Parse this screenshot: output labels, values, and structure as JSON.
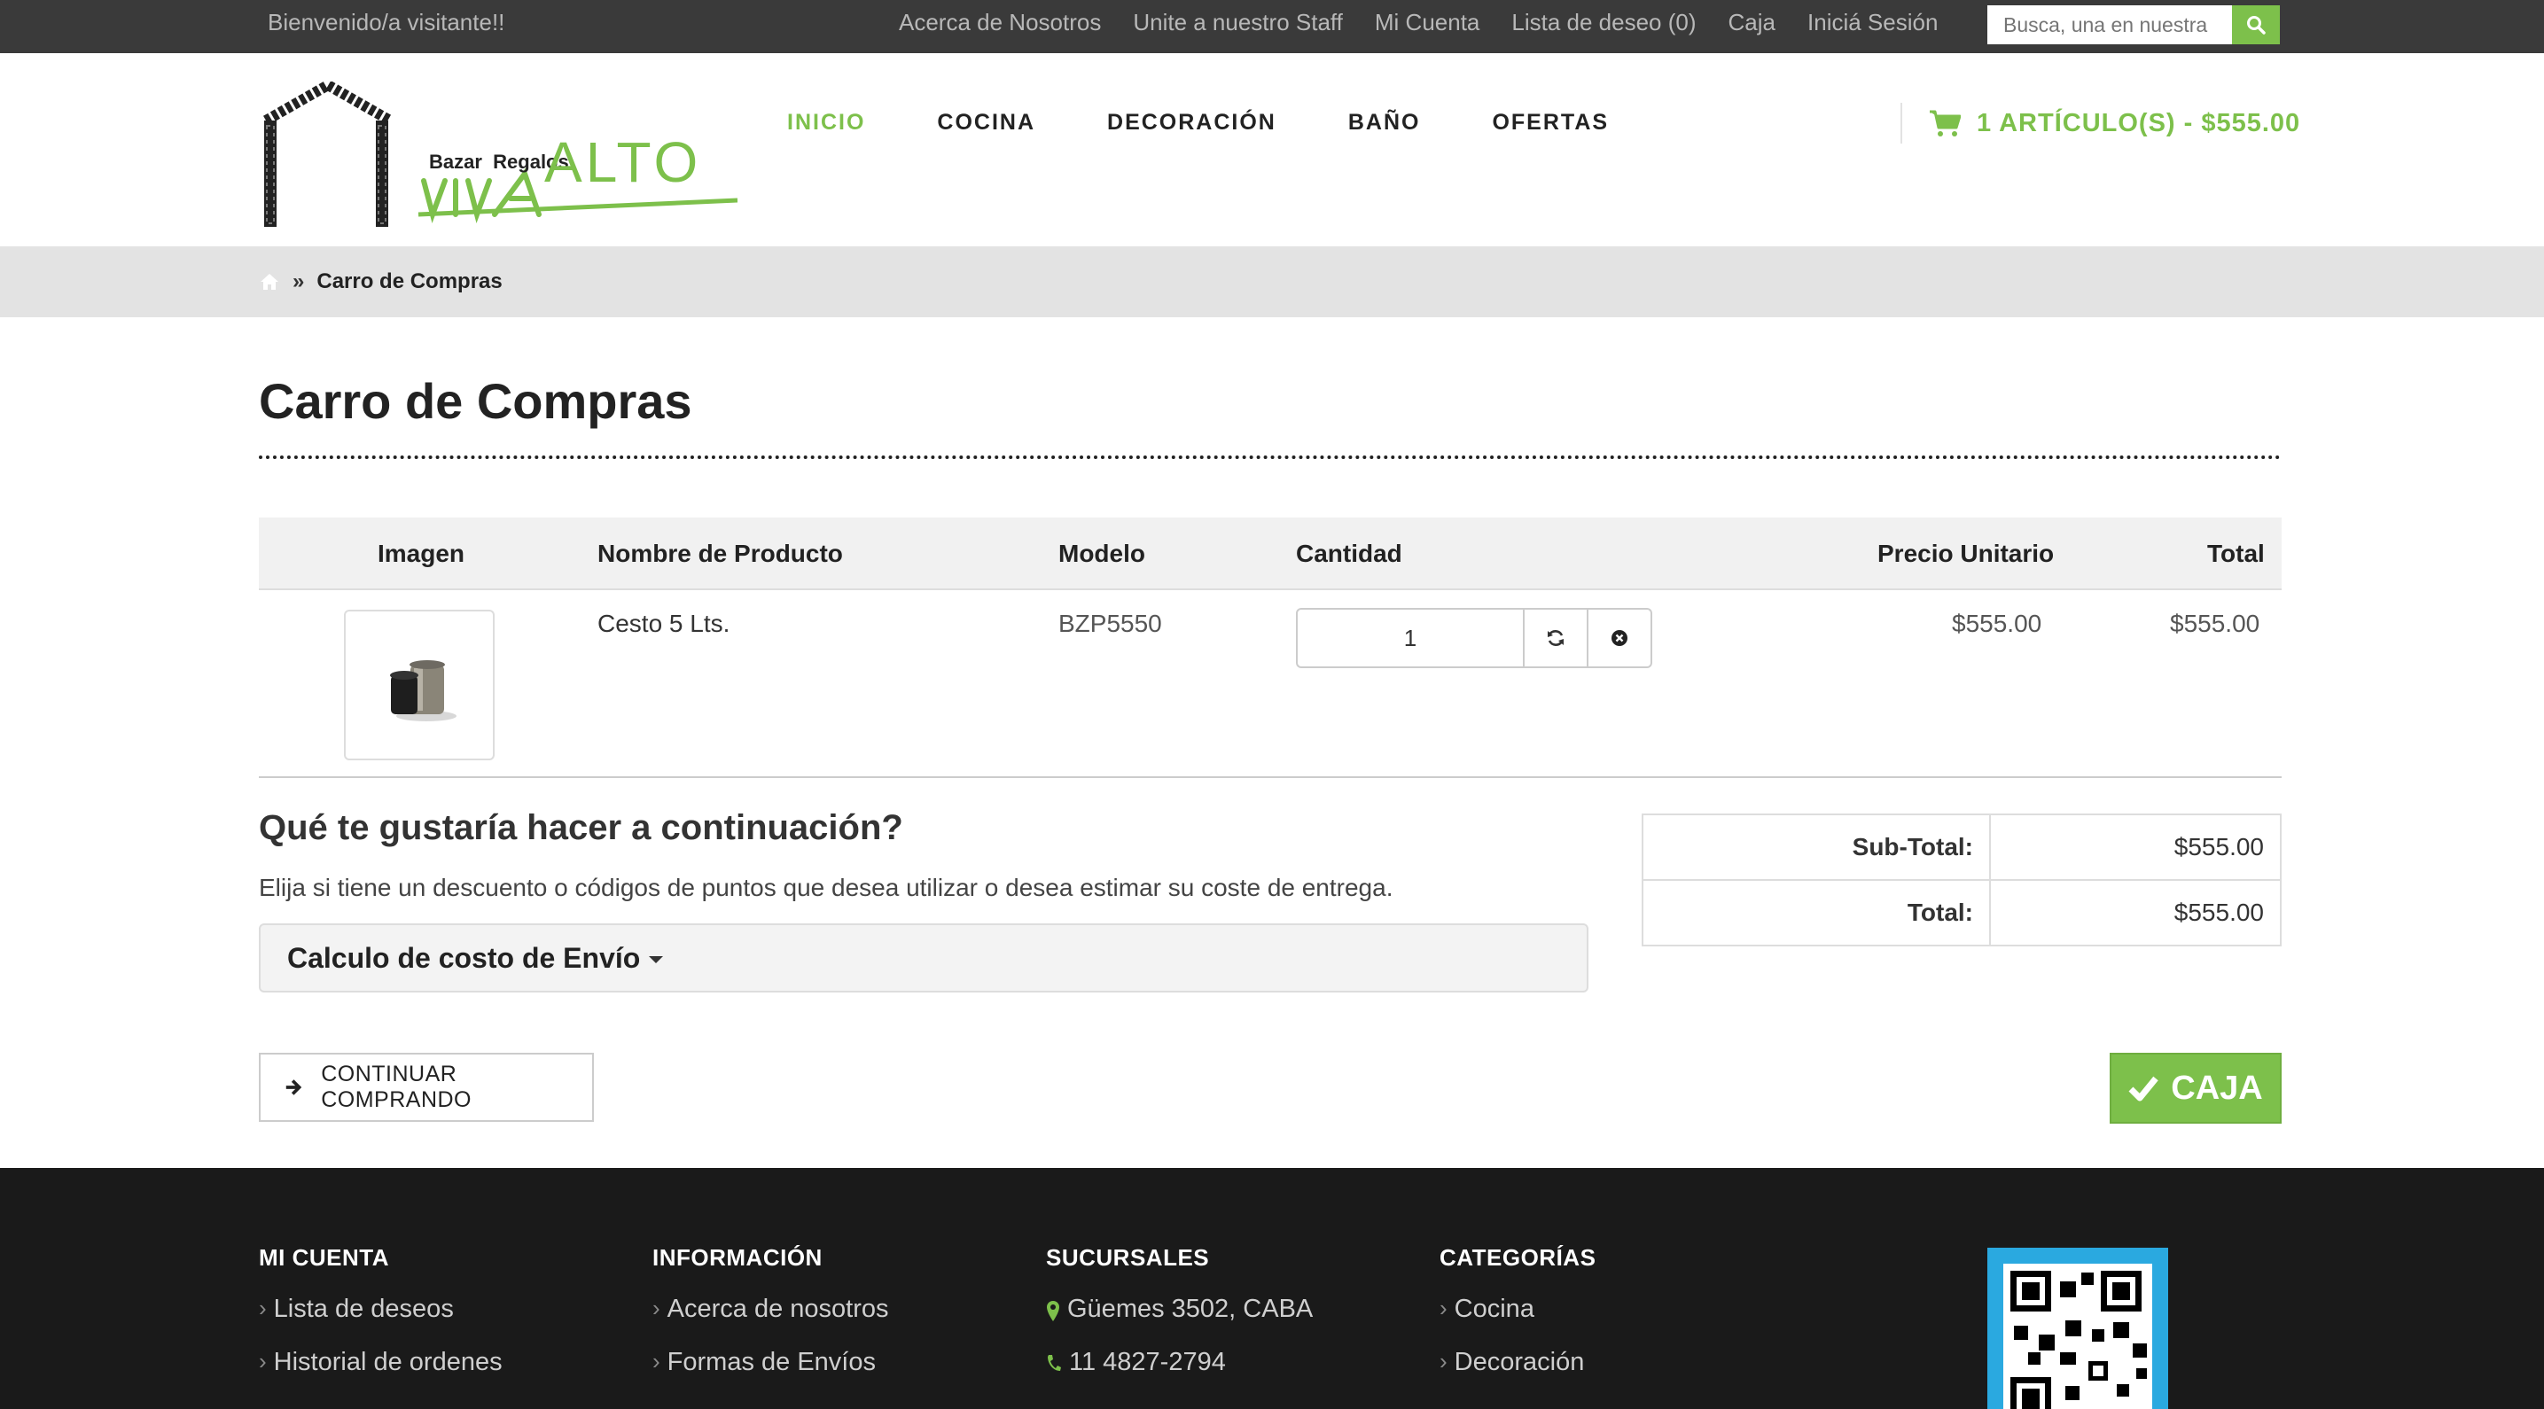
{
  "topbar": {
    "welcome": "Bienvenido/a visitante!!",
    "links": [
      "Acerca de Nosotros",
      "Unite a nuestro Staff",
      "Mi Cuenta",
      "Lista de deseo (0)",
      "Caja",
      "Iniciá Sesión"
    ],
    "search_placeholder": "Busca, una en nuestra",
    "search_icon": "search-icon"
  },
  "header": {
    "logo_text": {
      "line1": "Bazar  Regalos",
      "brand": "ALTO"
    },
    "nav": [
      "INICIO",
      "COCINA",
      "DECORACIÓN",
      "BAÑO",
      "OFERTAS"
    ],
    "active_nav": "INICIO",
    "cart_summary": "1 ARTÍCULO(S) - $555.00",
    "cart_icon": "shopping-cart-icon"
  },
  "breadcrumb": {
    "home_icon": "home-icon",
    "separator": "»",
    "current": "Carro de Compras"
  },
  "page": {
    "title": "Carro de Compras"
  },
  "cart_table": {
    "headers": {
      "image": "Imagen",
      "name": "Nombre de Producto",
      "model": "Modelo",
      "quantity": "Cantidad",
      "unit_price": "Precio Unitario",
      "total": "Total"
    },
    "rows": [
      {
        "name": "Cesto 5 Lts.",
        "model": "BZP5550",
        "quantity": "1",
        "unit_price": "$555.00",
        "total": "$555.00",
        "update_icon": "refresh-icon",
        "remove_icon": "remove-circle-icon"
      }
    ]
  },
  "next_steps": {
    "title": "Qué te gustaría hacer a continuación?",
    "description": "Elija si tiene un descuento o códigos de puntos que desea utilizar o desea estimar su coste de entrega.",
    "shipping_panel": "Calculo de costo de Envío"
  },
  "totals": [
    {
      "label": "Sub-Total:",
      "value": "$555.00"
    },
    {
      "label": "Total:",
      "value": "$555.00"
    }
  ],
  "buttons": {
    "continue_shopping": "CONTINUAR COMPRANDO",
    "checkout": "CAJA"
  },
  "footer": {
    "columns": [
      {
        "heading": "MI CUENTA",
        "items": [
          "Lista de deseos",
          "Historial de ordenes"
        ]
      },
      {
        "heading": "INFORMACIÓN",
        "items": [
          "Acerca de nosotros",
          "Formas de Envíos"
        ]
      },
      {
        "heading": "SUCURSALES",
        "items": [
          "Güemes 3502, CABA",
          "11 4827-2794"
        ]
      },
      {
        "heading": "CATEGORÍAS",
        "items": [
          "Cocina",
          "Decoración"
        ]
      }
    ]
  },
  "colors": {
    "accent": "#7dc04b",
    "topbar": "#3a3a3a",
    "footer": "#1a1a1a",
    "breadcrumb_bg": "#e3e3e3"
  }
}
